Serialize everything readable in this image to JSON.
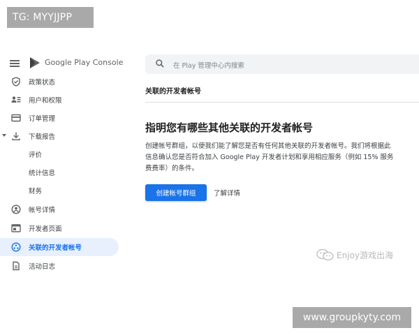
{
  "overlay": {
    "top_label": "TG: MYYJJPP",
    "bottom_label": "www.groupkyty.com"
  },
  "brand": {
    "name": "Google Play Console",
    "icon": "play-logo-icon"
  },
  "sidebar": {
    "items": [
      {
        "label": "政策状态",
        "icon": "shield-check-icon"
      },
      {
        "label": "用户和权限",
        "icon": "users-icon"
      },
      {
        "label": "订单管理",
        "icon": "credit-card-icon"
      },
      {
        "label": "下载报告",
        "icon": "download-icon",
        "expanded": true
      },
      {
        "label": "评价",
        "sub": true
      },
      {
        "label": "统计信息",
        "sub": true
      },
      {
        "label": "财务",
        "sub": true
      },
      {
        "label": "帐号详情",
        "icon": "account-circle-icon"
      },
      {
        "label": "开发者页面",
        "icon": "web-page-icon"
      },
      {
        "label": "关联的开发者帐号",
        "icon": "linked-accounts-icon",
        "active": true
      },
      {
        "label": "活动日志",
        "icon": "document-icon"
      }
    ]
  },
  "search": {
    "placeholder": "在 Play 管理中心内搜索"
  },
  "main": {
    "section_title": "关联的开发者帐号",
    "headline": "指明您有哪些其他关联的开发者帐号",
    "description": "创建帐号群组，以便我们能了解您是否有任何其他关联的开发者帐号。我们将根据此信息确认您是否符合加入 Google Play 开发者计划和享用相应服务（例如 15% 服务费费率）的条件。",
    "primary_button": "创建帐号群组",
    "secondary_link": "了解详情"
  },
  "watermark": {
    "text": "Enjoy游戏出海",
    "icon": "wechat-icon"
  },
  "colors": {
    "accent": "#1a73e8",
    "active_bg": "#e8f0fe"
  }
}
